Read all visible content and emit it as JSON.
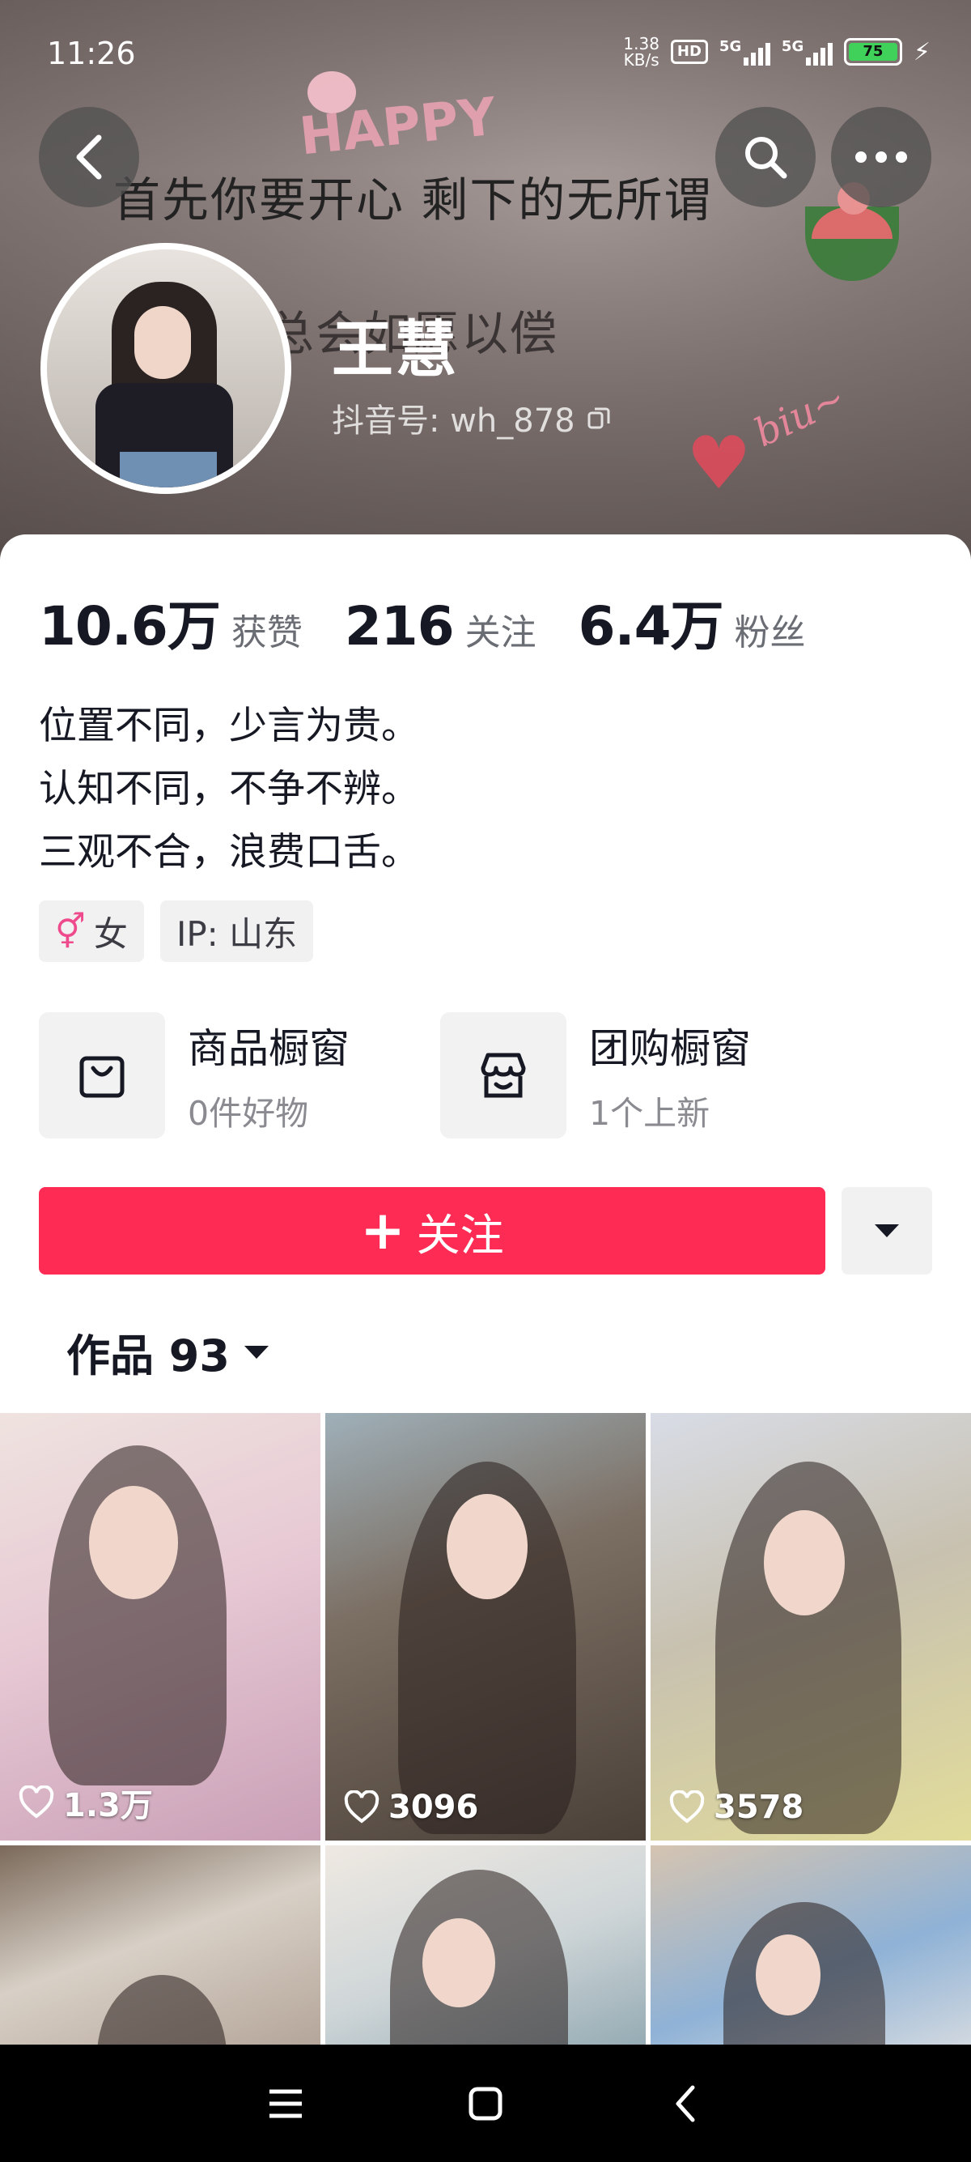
{
  "status_bar": {
    "time": "11:26",
    "net_speed_value": "1.38",
    "net_speed_unit": "KB/s",
    "hd": "HD",
    "signal1": "5G",
    "signal2": "5G",
    "battery": "75"
  },
  "cover": {
    "line1": "首先你要开心 剩下的无所谓",
    "line2": "总会如愿以偿",
    "sticker": "HAPPY",
    "biu": "biu~"
  },
  "profile": {
    "name": "王慧",
    "douyin_id": "抖音号: wh_878"
  },
  "stats": [
    {
      "num": "10.6万",
      "label": "获赞"
    },
    {
      "num": "216",
      "label": "关注"
    },
    {
      "num": "6.4万",
      "label": "粉丝"
    }
  ],
  "bio": [
    "位置不同，少言为贵。",
    "认知不同，不争不辨。",
    "三观不合，浪费口舌。"
  ],
  "tags": {
    "gender_symbol": "⚥",
    "gender": "女",
    "ip": "IP: 山东"
  },
  "shops": [
    {
      "title": "商品橱窗",
      "sub": "0件好物",
      "icon": "shopping-bag-icon"
    },
    {
      "title": "团购橱窗",
      "sub": "1个上新",
      "icon": "store-icon"
    }
  ],
  "follow": {
    "label": "关注"
  },
  "works_tab": {
    "label": "作品 93"
  },
  "videos": [
    {
      "likes": "1.3万"
    },
    {
      "likes": "3096"
    },
    {
      "likes": "3578"
    }
  ],
  "colors": {
    "accent": "#fe2c55",
    "text": "#161823"
  }
}
